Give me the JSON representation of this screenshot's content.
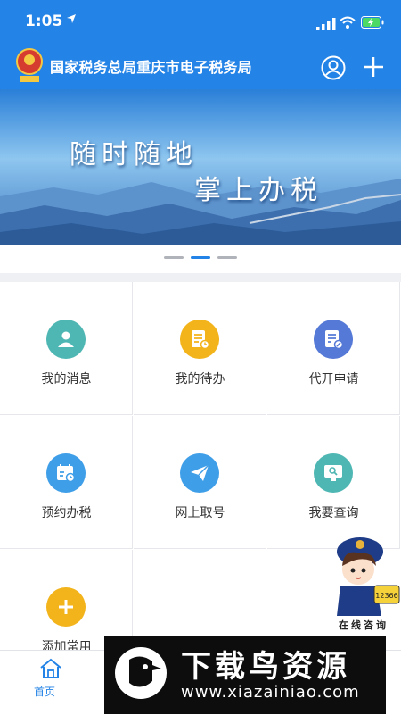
{
  "status_bar": {
    "time": "1:05",
    "location_icon": "location-arrow-icon",
    "signal_icon": "signal-icon",
    "wifi_icon": "wifi-icon",
    "battery_icon": "battery-charging-icon"
  },
  "header": {
    "title": "国家税务总局重庆市电子税务局",
    "emblem_icon": "tax-emblem-icon",
    "user_icon": "user-icon",
    "add_icon": "plus-icon"
  },
  "banner": {
    "line1": "随时随地",
    "line2": "掌上办税",
    "active_index": 1,
    "count": 3
  },
  "grid": {
    "items": [
      {
        "label": "我的消息",
        "icon": "person-icon",
        "color": "#4fb7b3"
      },
      {
        "label": "我的待办",
        "icon": "todo-list-icon",
        "color": "#f2b31b"
      },
      {
        "label": "代开申请",
        "icon": "document-edit-icon",
        "color": "#5579d6"
      },
      {
        "label": "预约办税",
        "icon": "calendar-icon",
        "color": "#3f9ee8"
      },
      {
        "label": "网上取号",
        "icon": "paper-plane-icon",
        "color": "#3f9ee8"
      },
      {
        "label": "我要查询",
        "icon": "monitor-search-icon",
        "color": "#4fb7b3"
      },
      {
        "label": "添加常用",
        "icon": "plus-icon",
        "color": "#f2b31b"
      }
    ]
  },
  "bottom_nav": {
    "home_label": "首页",
    "home_icon": "home-icon"
  },
  "online_consult": {
    "label": "在线咨询",
    "hotline": "12366"
  },
  "watermark": {
    "title": "下载鸟资源",
    "url": "www.xiazainiao.com"
  },
  "colors": {
    "primary": "#2483e6",
    "background": "#eef0f3"
  }
}
